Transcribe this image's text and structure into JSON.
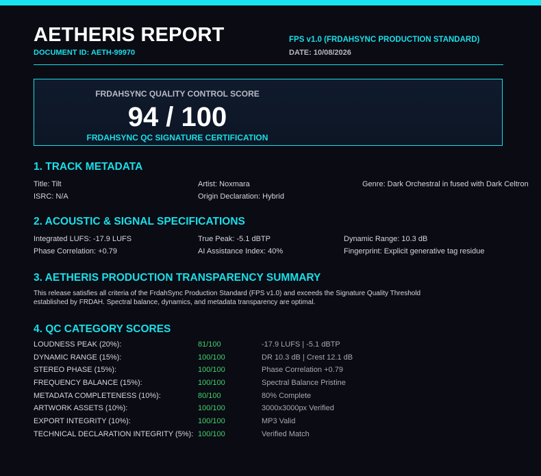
{
  "header": {
    "title": "AETHERIS REPORT",
    "document_id": "DOCUMENT ID: AETH-99970",
    "standard": "FPS v1.0 (FRDAHSYNC PRODUCTION STANDARD)",
    "date": "DATE: 10/08/2026"
  },
  "score_box": {
    "label": "FRDAHSYNC QUALITY CONTROL SCORE",
    "score": "94 / 100",
    "certification": "FRDAHSYNC QC SIGNATURE CERTIFICATION"
  },
  "metadata": {
    "heading": "1. TRACK METADATA",
    "title": "Title: Tilt",
    "artist": "Artist: Noxmara",
    "genre": "Genre: Dark Orchestral in fused with Dark Celtron",
    "isrc": "ISRC: N/A",
    "origin": "Origin Declaration: Hybrid"
  },
  "specs": {
    "heading": "2. ACOUSTIC & SIGNAL SPECIFICATIONS",
    "lufs": "Integrated LUFS: -17.9 LUFS",
    "true_peak": "True Peak: -5.1 dBTP",
    "dynamic_range": "Dynamic Range: 10.3 dB",
    "phase": "Phase Correlation: +0.79",
    "ai_index": "AI Assistance Index: 40%",
    "fingerprint": "Fingerprint: Explicit generative tag residue"
  },
  "summary": {
    "heading": "3. AETHERIS PRODUCTION TRANSPARENCY SUMMARY",
    "line1": "This release satisfies all criteria of the FrdahSync Production Standard (FPS v1.0) and exceeds the Signature Quality Threshold",
    "line2": "established by FRDAH. Spectral balance, dynamics, and metadata transparency are optimal."
  },
  "qc": {
    "heading": "4. QC CATEGORY SCORES",
    "rows": [
      {
        "category": "LOUDNESS PEAK (20%):",
        "score": "81/100",
        "detail": "-17.9 LUFS | -5.1 dBTP"
      },
      {
        "category": "DYNAMIC RANGE (15%):",
        "score": "100/100",
        "detail": "DR 10.3 dB | Crest 12.1 dB"
      },
      {
        "category": "STEREO PHASE (15%):",
        "score": "100/100",
        "detail": "Phase Correlation +0.79"
      },
      {
        "category": "FREQUENCY BALANCE (15%):",
        "score": "100/100",
        "detail": "Spectral Balance Pristine"
      },
      {
        "category": "METADATA COMPLETENESS (10%):",
        "score": "80/100",
        "detail": "80% Complete"
      },
      {
        "category": "ARTWORK ASSETS (10%):",
        "score": "100/100",
        "detail": "3000x3000px Verified"
      },
      {
        "category": "EXPORT INTEGRITY (10%):",
        "score": "100/100",
        "detail": "MP3 Valid"
      },
      {
        "category": "TECHNICAL DECLARATION INTEGRITY (5%):",
        "score": "100/100",
        "detail": "Verified Match"
      }
    ]
  },
  "colors": {
    "accent": "#19dfe8",
    "score_green": "#3fd36a",
    "background": "#0b0b14"
  }
}
